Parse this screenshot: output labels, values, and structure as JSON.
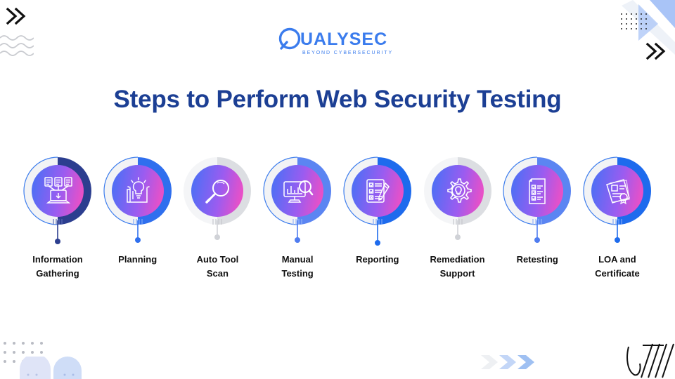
{
  "brand": {
    "logo_text": "QUALYSEC",
    "tagline": "BEYOND CYBERSECURITY",
    "logo_color": "#3b7ced"
  },
  "header": {
    "title": "Steps to Perform Web Security Testing",
    "title_color": "#1c3f94"
  },
  "theme": {
    "background": "#ffffff",
    "gradient_start": "#4e6ff5",
    "gradient_mid": "#9b5cf0",
    "gradient_end": "#ef4fc4",
    "ring_dark_navy": "#2c3e8f",
    "ring_blue": "#1e6bed",
    "ring_gray": "#d9dade",
    "ring_light": "#f2f3f5",
    "label_color": "#111111"
  },
  "steps": [
    {
      "index": 1,
      "label": "Information\nGathering",
      "icon": "documents-laptop-download-icon",
      "ring_accent": "#2c3e8f",
      "ring_style": "navy"
    },
    {
      "index": 2,
      "label": "Planning",
      "icon": "lightbulb-document-icon",
      "ring_accent": "#1e6bed",
      "ring_style": "blue"
    },
    {
      "index": 3,
      "label": "Auto Tool\nScan",
      "icon": "magnifying-glass-icon",
      "ring_accent": "#d9dade",
      "ring_style": "gray"
    },
    {
      "index": 4,
      "label": "Manual\nTesting",
      "icon": "monitor-chart-search-icon",
      "ring_accent": "#4a7ef0",
      "ring_style": "blue"
    },
    {
      "index": 5,
      "label": "Reporting",
      "icon": "checklist-pencil-icon",
      "ring_accent": "#1e6bed",
      "ring_style": "blue"
    },
    {
      "index": 6,
      "label": "Remediation\nSupport",
      "icon": "gear-lightbulb-icon",
      "ring_accent": "#d9dade",
      "ring_style": "gray"
    },
    {
      "index": 7,
      "label": "Retesting",
      "icon": "document-checkboxes-icon",
      "ring_accent": "#4a7ef0",
      "ring_style": "blue"
    },
    {
      "index": 8,
      "label": "LOA and\nCertificate",
      "icon": "certificate-seal-icon",
      "ring_accent": "#1e6bed",
      "ring_style": "blue"
    }
  ],
  "decorations": {
    "top_left_chevron": "double-chevron-right-icon",
    "top_left_waves": "wavy-lines-decoration",
    "top_right_dots": "dot-grid-decoration",
    "top_right_triangles": "triangle-shapes-decoration",
    "top_right_chevron": "double-chevron-right-icon",
    "bottom_left_dots": "dot-grid-decoration",
    "bottom_left_arches": "arch-shapes-decoration",
    "bottom_right_chevrons": "chevron-arrows-decoration",
    "bottom_right_scribble": "scribble-lines-decoration"
  }
}
